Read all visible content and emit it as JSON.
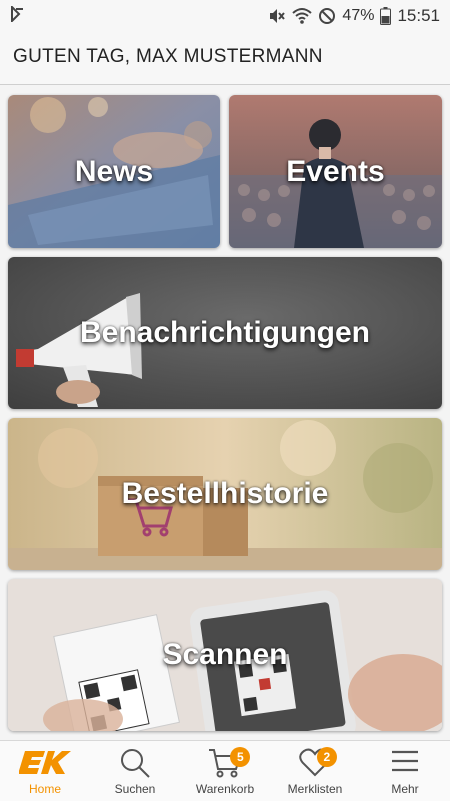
{
  "status_bar": {
    "battery_percent": "47%",
    "time": "15:51",
    "icons": [
      "notification-icon",
      "mute-icon",
      "wifi-icon",
      "block-icon",
      "battery-icon"
    ]
  },
  "header": {
    "greeting": "GUTEN TAG, MAX MUSTERMANN"
  },
  "tiles": [
    {
      "label": "News",
      "icon": "news-image"
    },
    {
      "label": "Events",
      "icon": "events-image"
    },
    {
      "label": "Benachrichtigungen",
      "icon": "megaphone-image"
    },
    {
      "label": "Bestellhistorie",
      "icon": "package-image"
    },
    {
      "label": "Scannen",
      "icon": "qr-scan-image"
    }
  ],
  "bottom_nav": {
    "accent_color": "#f39200",
    "items": [
      {
        "label": "Home",
        "icon": "ek-logo-icon",
        "active": true
      },
      {
        "label": "Suchen",
        "icon": "search-icon"
      },
      {
        "label": "Warenkorb",
        "icon": "cart-icon",
        "badge": "5"
      },
      {
        "label": "Merklisten",
        "icon": "heart-icon",
        "badge": "2"
      },
      {
        "label": "Mehr",
        "icon": "menu-icon"
      }
    ]
  }
}
